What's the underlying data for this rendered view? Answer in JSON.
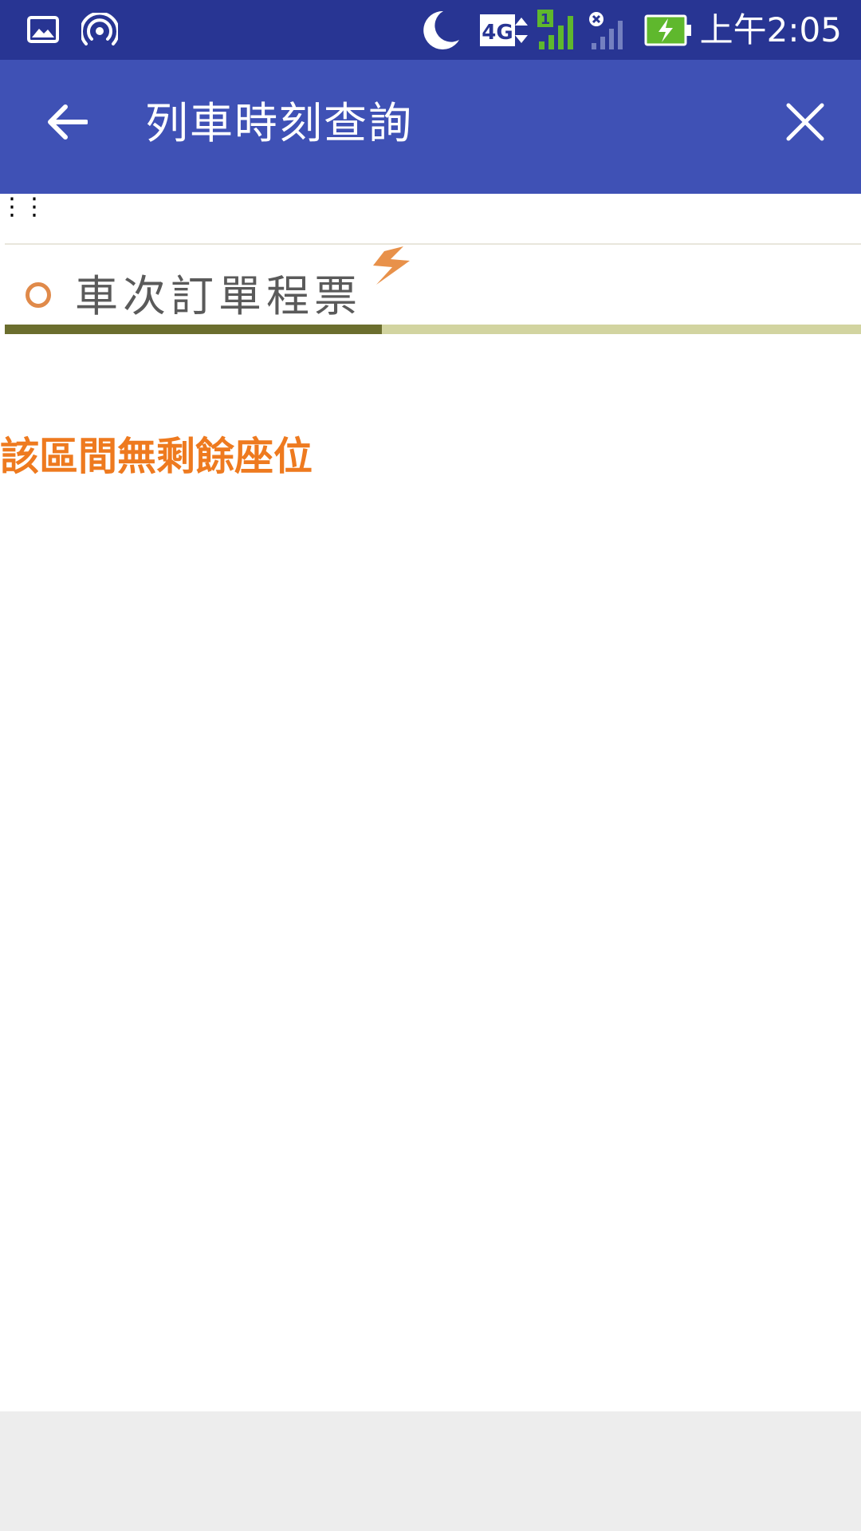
{
  "status_bar": {
    "time": "上午2:05",
    "network_label": "4G",
    "sim_slot": "1",
    "icons": [
      "gallery-icon",
      "hotspot-icon",
      "moon-icon",
      "network-4g-icon",
      "signal-icon",
      "no-signal-icon",
      "battery-charging-icon"
    ]
  },
  "app_bar": {
    "title": "列車時刻查詢",
    "back_icon": "arrow-left-icon",
    "close_icon": "close-icon"
  },
  "page": {
    "ellipsis": "⋮⋮",
    "banner_title": "車次訂單程票",
    "progress": 0.44,
    "message": "該區間無剩餘座位"
  },
  "colors": {
    "status_bar": "#283593",
    "app_bar": "#3f51b5",
    "message": "#ee7a1f",
    "progress_fill": "#6b6e2e",
    "progress_track": "#d2d4a0"
  }
}
